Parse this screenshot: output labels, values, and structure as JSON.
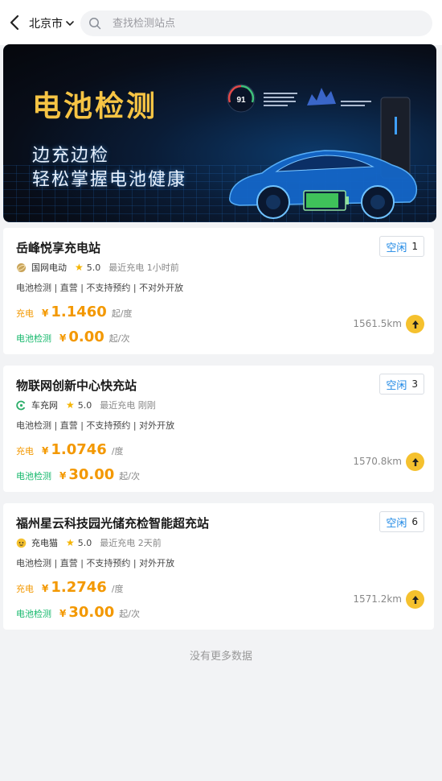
{
  "header": {
    "city": "北京市",
    "search_placeholder": "查找检测站点"
  },
  "banner": {
    "title": "电池检测",
    "subtitle_line1": "边充边检",
    "subtitle_line2": "轻松掌握电池健康",
    "gauge_value": "91"
  },
  "labels": {
    "charge": "充电",
    "battery_test": "电池检测",
    "yen": "¥"
  },
  "stations": [
    {
      "name": "岳峰悦享充电站",
      "status": "空闲",
      "count": "1",
      "operator": "国网电动",
      "operator_icon": "state-grid-icon",
      "rating": "5.0",
      "recent": "最近充电 1小时前",
      "tags": "电池检测 | 直营 | 不支持预约 | 不对外开放",
      "charge_price": "1.1460",
      "charge_unit": "起/度",
      "test_price": "0.00",
      "test_unit": "起/次",
      "distance": "1561.5km"
    },
    {
      "name": "物联网创新中心快充站",
      "status": "空闲",
      "count": "3",
      "operator": "车充网",
      "operator_icon": "charging-network-icon",
      "rating": "5.0",
      "recent": "最近充电 刚刚",
      "tags": "电池检测 | 直营 | 不支持预约 | 对外开放",
      "charge_price": "1.0746",
      "charge_unit": "/度",
      "test_price": "30.00",
      "test_unit": "起/次",
      "distance": "1570.8km"
    },
    {
      "name": "福州星云科技园光储充检智能超充站",
      "status": "空闲",
      "count": "6",
      "operator": "充电猫",
      "operator_icon": "charging-cat-icon",
      "rating": "5.0",
      "recent": "最近充电 2天前",
      "tags": "电池检测 | 直营 | 不支持预约 | 对外开放",
      "charge_price": "1.2746",
      "charge_unit": "/度",
      "test_price": "30.00",
      "test_unit": "起/次",
      "distance": "1571.2km"
    }
  ],
  "footer": {
    "no_more": "没有更多数据"
  },
  "colors": {
    "accent_blue": "#1e88e5",
    "price_orange": "#f39800",
    "test_green": "#14b86b",
    "nav_yellow": "#f5c12e",
    "banner_title_gold": "#f6c444"
  }
}
